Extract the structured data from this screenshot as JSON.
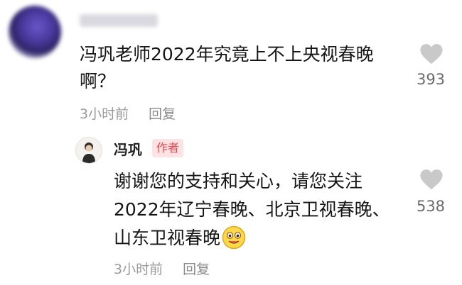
{
  "comment": {
    "text": "冯巩老师2022年究竟上不上央视春晚啊？",
    "time": "3小时前",
    "reply_label": "回复",
    "likes": "393"
  },
  "reply": {
    "author": "冯巩",
    "badge": "作者",
    "text": "谢谢您的支持和关心，请您关注2022年辽宁春晚、北京卫视春晚、山东卫视春晚",
    "time": "3小时前",
    "reply_label": "回复",
    "likes": "538"
  },
  "icons": {
    "like": "heart-icon",
    "emoji": "smiley-emoji-icon"
  },
  "colors": {
    "badge_text": "#e8464f",
    "badge_bg": "#fde3e3",
    "meta_text": "#9a9a9a"
  }
}
